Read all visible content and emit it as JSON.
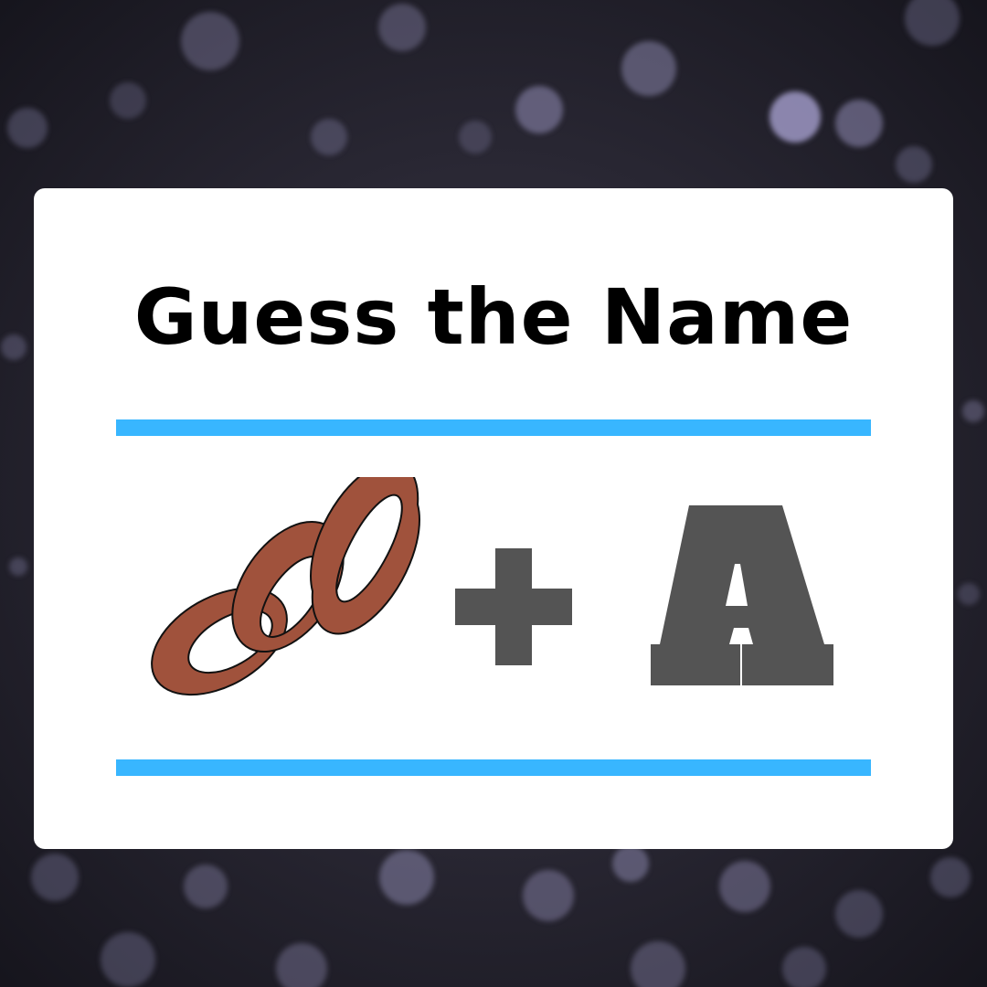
{
  "title": "Guess the Name",
  "puzzle": {
    "clue_1": "chain-icon",
    "operator": "plus-icon",
    "clue_2_letter": "A"
  },
  "colors": {
    "background": "#2a2836",
    "card": "#ffffff",
    "title": "#000000",
    "rule": "#38b6ff",
    "chain": "#a0523c",
    "symbols": "#545454"
  }
}
